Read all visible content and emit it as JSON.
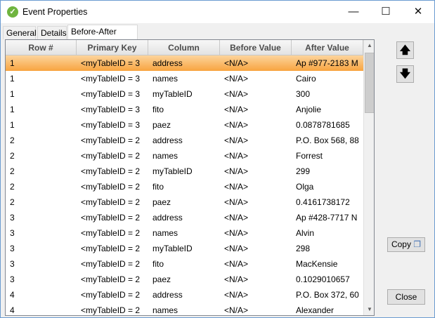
{
  "window": {
    "title": "Event Properties",
    "icon": "check-circle-icon",
    "minimize": "—",
    "maximize": "☐",
    "close": "✕"
  },
  "tabs": [
    {
      "label": "General"
    },
    {
      "label": "Details"
    },
    {
      "label": "Before-After Data",
      "active": true
    }
  ],
  "table": {
    "columns": [
      "Row #",
      "Primary Key",
      "Column",
      "Before Value",
      "After Value"
    ],
    "rows": [
      [
        "1",
        "<myTableID = 3",
        "address",
        "<N/A>",
        "Ap #977-2183 M"
      ],
      [
        "1",
        "<myTableID = 3",
        "names",
        "<N/A>",
        "Cairo"
      ],
      [
        "1",
        "<myTableID = 3",
        "myTableID",
        "<N/A>",
        "300"
      ],
      [
        "1",
        "<myTableID = 3",
        "fito",
        "<N/A>",
        "Anjolie"
      ],
      [
        "1",
        "<myTableID = 3",
        "paez",
        "<N/A>",
        "0.0878781685"
      ],
      [
        "2",
        "<myTableID = 2",
        "address",
        "<N/A>",
        "P.O. Box 568, 88"
      ],
      [
        "2",
        "<myTableID = 2",
        "names",
        "<N/A>",
        "Forrest"
      ],
      [
        "2",
        "<myTableID = 2",
        "myTableID",
        "<N/A>",
        "299"
      ],
      [
        "2",
        "<myTableID = 2",
        "fito",
        "<N/A>",
        "Olga"
      ],
      [
        "2",
        "<myTableID = 2",
        "paez",
        "<N/A>",
        "0.4161738172"
      ],
      [
        "3",
        "<myTableID = 2",
        "address",
        "<N/A>",
        "Ap #428-7717 N"
      ],
      [
        "3",
        "<myTableID = 2",
        "names",
        "<N/A>",
        "Alvin"
      ],
      [
        "3",
        "<myTableID = 2",
        "myTableID",
        "<N/A>",
        "298"
      ],
      [
        "3",
        "<myTableID = 2",
        "fito",
        "<N/A>",
        "MacKensie"
      ],
      [
        "3",
        "<myTableID = 2",
        "paez",
        "<N/A>",
        "0.1029010657"
      ],
      [
        "4",
        "<myTableID = 2",
        "address",
        "<N/A>",
        "P.O. Box 372, 60"
      ],
      [
        "4",
        "<myTableID = 2",
        "names",
        "<N/A>",
        "Alexander"
      ]
    ],
    "selected_row": 0,
    "selection_color": "#f8a440"
  },
  "buttons": {
    "up": "🡅",
    "down": "🡇",
    "copy": "Copy",
    "close": "Close"
  }
}
